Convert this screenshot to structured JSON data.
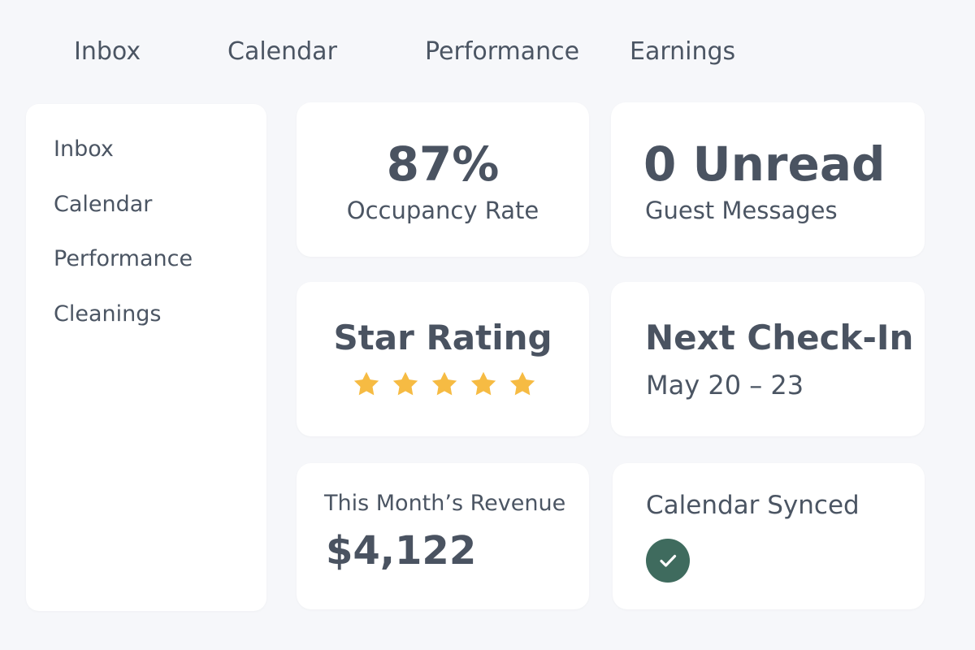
{
  "top_nav": {
    "tabs": [
      {
        "label": "Inbox"
      },
      {
        "label": "Calendar"
      },
      {
        "label": "Performance"
      },
      {
        "label": "Earnings"
      }
    ]
  },
  "sidebar": {
    "items": [
      {
        "label": "Inbox"
      },
      {
        "label": "Calendar"
      },
      {
        "label": "Performance"
      },
      {
        "label": "Cleanings"
      }
    ]
  },
  "cards": {
    "occupancy": {
      "value": "87%",
      "label": "Occupancy Rate"
    },
    "messages": {
      "value": "0 Unread",
      "label": "Guest Messages"
    },
    "rating": {
      "title": "Star Rating",
      "stars": 5,
      "max_stars": 5
    },
    "checkin": {
      "title": "Next Check-In",
      "dates": "May 20 – 23"
    },
    "revenue": {
      "label": "This Month’s Revenue",
      "value": "$4,122"
    },
    "calendar_sync": {
      "label": "Calendar Synced",
      "status_icon": "checkmark-circle-icon"
    }
  },
  "colors": {
    "background": "#f6f7fa",
    "card": "#ffffff",
    "text": "#4a5361",
    "star": "#f6bb43",
    "success": "#3f6b5e"
  }
}
